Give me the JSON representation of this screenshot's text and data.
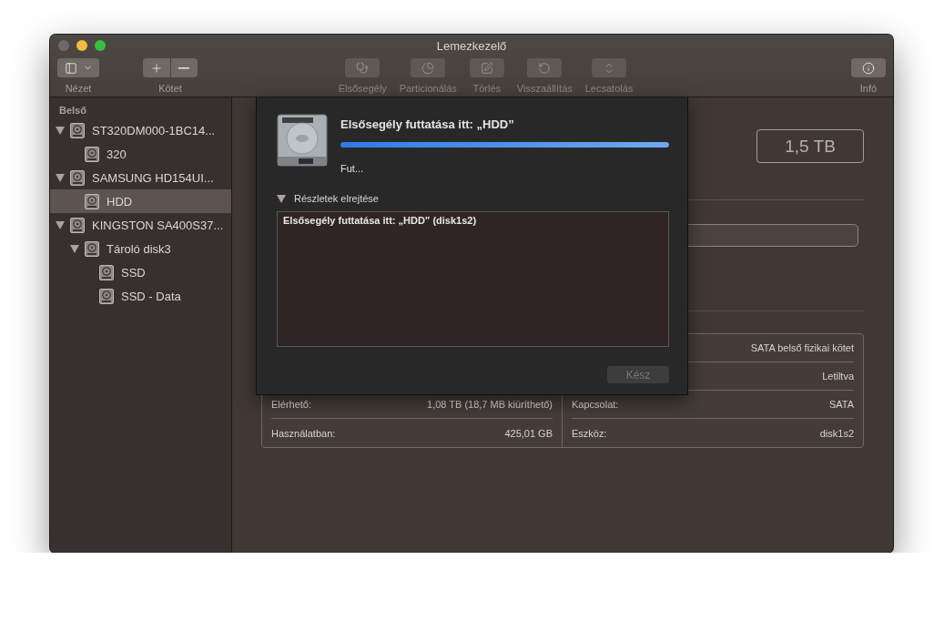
{
  "window": {
    "title": "Lemezkezelő"
  },
  "toolbar": [
    {
      "kind": "view",
      "label": "Nézet",
      "disabled": false
    },
    {
      "kind": "volume",
      "label": "Kötet",
      "disabled": false
    },
    {
      "kind": "firstaid",
      "label": "Elsősegély",
      "disabled": true
    },
    {
      "kind": "partition",
      "label": "Particionálás",
      "disabled": true
    },
    {
      "kind": "erase",
      "label": "Törlés",
      "disabled": true
    },
    {
      "kind": "restore",
      "label": "Visszaállítás",
      "disabled": true
    },
    {
      "kind": "unmount",
      "label": "Lecsatolás",
      "disabled": true
    },
    {
      "kind": "info",
      "label": "Infó",
      "disabled": false
    }
  ],
  "sidebar": {
    "section": "Belső",
    "items": [
      {
        "label": "ST320DM000-1BC14...",
        "expanded": true,
        "selected": false,
        "children": [
          {
            "label": "320",
            "selected": false
          }
        ]
      },
      {
        "label": "SAMSUNG HD154UI...",
        "expanded": true,
        "selected": false,
        "children": [
          {
            "label": "HDD",
            "selected": true
          }
        ]
      },
      {
        "label": "KINGSTON SA400S37...",
        "expanded": true,
        "selected": false,
        "children": [
          {
            "label": "Tároló disk3",
            "expanded": true,
            "selected": false,
            "children": [
              {
                "label": "SSD",
                "selected": false
              },
              {
                "label": "SSD - Data",
                "selected": false
              }
            ]
          }
        ]
      }
    ]
  },
  "volume": {
    "capacity": "1,5 TB"
  },
  "info": {
    "rows": [
      {
        "right_value": "SATA belső fizikai kötet"
      },
      {
        "right_value": "Letiltva"
      },
      {
        "left_label": "Elérhető:",
        "left_value": "1,08 TB (18,7 MB kiüríthető)",
        "right_label": "Kapcsolat:",
        "right_value": "SATA"
      },
      {
        "left_label": "Használatban:",
        "left_value": "425,01 GB",
        "right_label": "Eszköz:",
        "right_value": "disk1s2"
      }
    ]
  },
  "sheet": {
    "title": "Elsősegély futtatása itt: „HDD”",
    "progress": {
      "level": 1
    },
    "status": "Fut...",
    "details": {
      "label": "Részletek elrejtése",
      "expanded": true,
      "log": "Elsősegély futtatása itt: „HDD” (disk1s2)"
    },
    "button": {
      "label": "Kész",
      "disabled": true
    }
  }
}
